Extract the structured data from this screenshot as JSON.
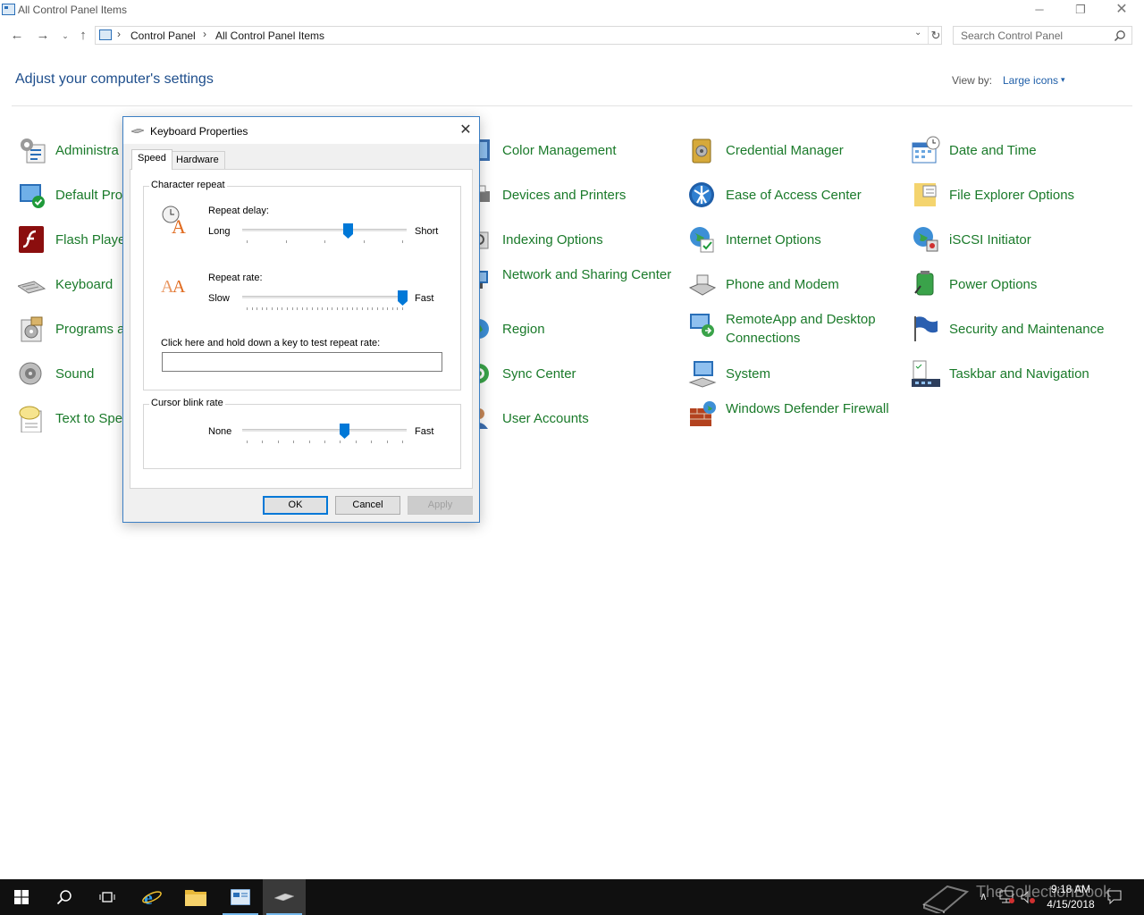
{
  "window": {
    "title": "All Control Panel Items",
    "minimize_glyph": "─",
    "maximize_glyph": "❐",
    "close_glyph": "✕"
  },
  "nav": {
    "back_glyph": "←",
    "forward_glyph": "→",
    "recent_glyph": "⌄",
    "up_glyph": "↑",
    "separator": "›",
    "breadcrumbs": [
      "Control Panel",
      "All Control Panel Items"
    ],
    "address_dropdown_glyph": "⌄",
    "refresh_glyph": "↻",
    "search_placeholder": "Search Control Panel"
  },
  "header": {
    "title": "Adjust your computer's settings",
    "view_by_label": "View by:",
    "view_by_value": "Large icons",
    "view_by_caret": "▾"
  },
  "items": [
    {
      "label": "Administrative Tools",
      "visible_label": "Administra",
      "icon": "administrative-tools-icon"
    },
    {
      "label": "Color Management",
      "icon": "color-management-icon"
    },
    {
      "label": "Credential Manager",
      "icon": "credential-manager-icon"
    },
    {
      "label": "Date and Time",
      "icon": "date-time-icon"
    },
    {
      "label": "Default Programs",
      "visible_label": "Default Pro",
      "icon": "default-programs-icon"
    },
    {
      "label": "Devices and Printers",
      "icon": "devices-printers-icon"
    },
    {
      "label": "Ease of Access Center",
      "icon": "ease-of-access-icon"
    },
    {
      "label": "File Explorer Options",
      "icon": "file-explorer-options-icon"
    },
    {
      "label": "Flash Player",
      "visible_label": "Flash Playe",
      "icon": "flash-player-icon"
    },
    {
      "label": "Indexing Options",
      "icon": "indexing-options-icon"
    },
    {
      "label": "Internet Options",
      "icon": "internet-options-icon"
    },
    {
      "label": "iSCSI Initiator",
      "icon": "iscsi-initiator-icon"
    },
    {
      "label": "Keyboard",
      "icon": "keyboard-icon"
    },
    {
      "label": "Network and Sharing Center",
      "icon": "network-sharing-icon"
    },
    {
      "label": "Phone and Modem",
      "icon": "phone-modem-icon"
    },
    {
      "label": "Power Options",
      "icon": "power-options-icon"
    },
    {
      "label": "Programs and Features",
      "visible_label": "Programs a",
      "icon": "programs-features-icon"
    },
    {
      "label": "Region",
      "icon": "region-icon"
    },
    {
      "label": "RemoteApp and Desktop Connections",
      "icon": "remoteapp-icon"
    },
    {
      "label": "Security and Maintenance",
      "icon": "security-maintenance-icon"
    },
    {
      "label": "Sound",
      "icon": "sound-icon"
    },
    {
      "label": "Sync Center",
      "icon": "sync-center-icon"
    },
    {
      "label": "System",
      "icon": "system-icon"
    },
    {
      "label": "Taskbar and Navigation",
      "icon": "taskbar-navigation-icon"
    },
    {
      "label": "Text to Speech",
      "visible_label": "Text to Spe",
      "icon": "text-to-speech-icon"
    },
    {
      "label": "User Accounts",
      "icon": "user-accounts-icon"
    },
    {
      "label": "Windows Defender Firewall",
      "icon": "firewall-icon"
    }
  ],
  "dialog": {
    "title": "Keyboard Properties",
    "close_glyph": "✕",
    "tabs": [
      "Speed",
      "Hardware"
    ],
    "active_tab": "Speed",
    "character_repeat": {
      "group_title": "Character repeat",
      "repeat_delay": {
        "label": "Repeat delay:",
        "min_label": "Long",
        "max_label": "Short",
        "value_fraction": 0.65
      },
      "repeat_rate": {
        "label": "Repeat rate:",
        "min_label": "Slow",
        "max_label": "Fast",
        "value_fraction": 1.0
      },
      "test_prompt": "Click here and hold down a key to test repeat rate:",
      "test_value": ""
    },
    "cursor_blink": {
      "group_title": "Cursor blink rate",
      "min_label": "None",
      "max_label": "Fast",
      "value_fraction": 0.63
    },
    "buttons": {
      "ok": "OK",
      "cancel": "Cancel",
      "apply": "Apply"
    }
  },
  "taskbar": {
    "buttons": [
      "start-button",
      "search-button",
      "task-view-button",
      "internet-explorer-button",
      "file-explorer-button",
      "control-panel-button",
      "keyboard-properties-button"
    ],
    "watermark": "TheCollectionBook",
    "tray_up_glyph": "∧",
    "time": "9:18 AM",
    "date": "4/15/2018"
  },
  "colors": {
    "link_green": "#1a7a2a",
    "title_blue": "#1e4e8c",
    "accent": "#0078d7",
    "taskbar": "#101010"
  }
}
